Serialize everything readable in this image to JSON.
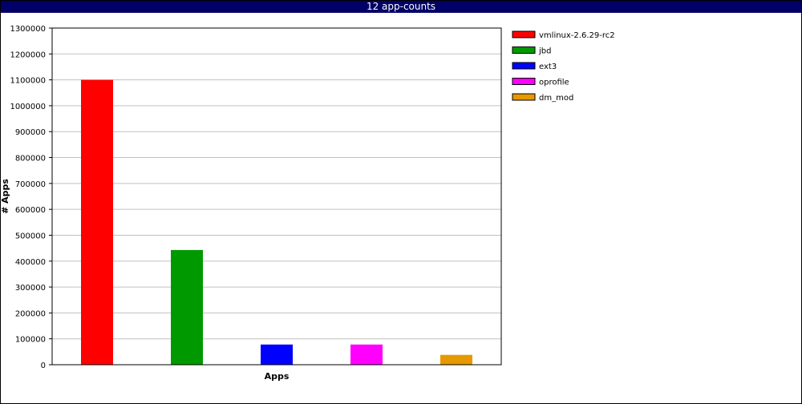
{
  "window": {
    "title": "12 app-counts"
  },
  "chart_data": {
    "type": "bar",
    "title": "12 app-counts",
    "xlabel": "Apps",
    "ylabel": "# Apps",
    "ylim": [
      0,
      1300000
    ],
    "yticks": [
      0,
      100000,
      200000,
      300000,
      400000,
      500000,
      600000,
      700000,
      800000,
      900000,
      1000000,
      1100000,
      1200000,
      1300000
    ],
    "grid": true,
    "legend_position": "right",
    "series": [
      {
        "name": "vmlinux-2.6.29-rc2",
        "value": 1100000,
        "color": "#ff0000"
      },
      {
        "name": "jbd",
        "value": 443000,
        "color": "#009900"
      },
      {
        "name": "ext3",
        "value": 78000,
        "color": "#0000ff"
      },
      {
        "name": "oprofile",
        "value": 78000,
        "color": "#ff00ff"
      },
      {
        "name": "dm_mod",
        "value": 38000,
        "color": "#e69900"
      }
    ]
  }
}
